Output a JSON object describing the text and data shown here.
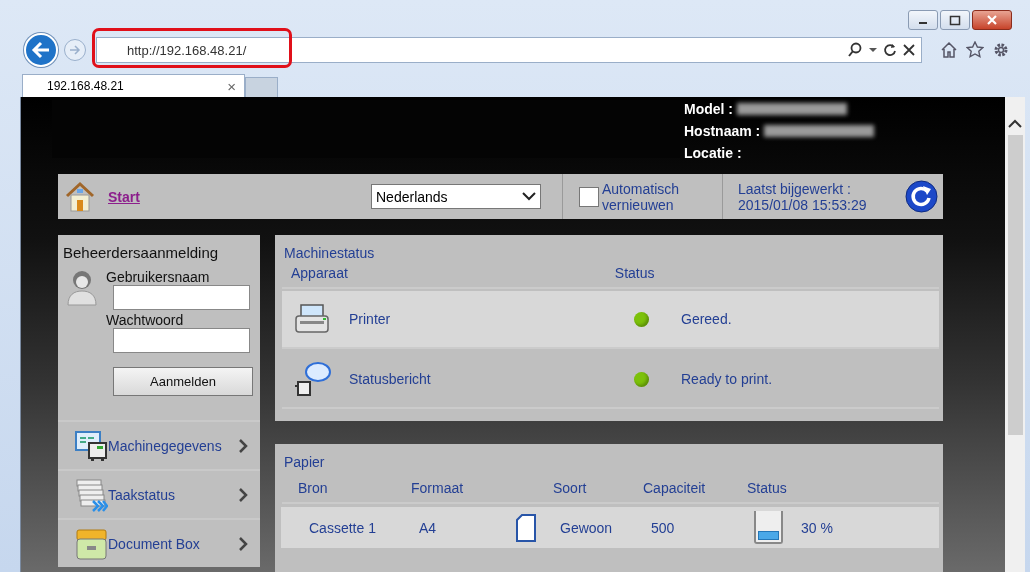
{
  "window": {
    "buttons": [
      {
        "kind": "minimize"
      },
      {
        "kind": "maximize"
      },
      {
        "kind": "close"
      }
    ]
  },
  "address_bar": {
    "url": "http://192.168.48.21/",
    "highlighted": true
  },
  "tabs": [
    {
      "label": "192.168.48.21",
      "close": "×",
      "selected": true
    }
  ],
  "device_info": [
    {
      "label": "Model :",
      "value_hidden": true
    },
    {
      "label": "Hostnaam :",
      "value_hidden": true
    },
    {
      "label": "Locatie :",
      "value_hidden": false
    }
  ],
  "toolbar": {
    "start_link": "Start",
    "language": "Nederlands",
    "auto_refresh": {
      "label": "Automatisch vernieuwen",
      "checked": false
    },
    "last_updated_label": "Laatst bijgewerkt :",
    "last_updated_value": "2015/01/08 15:53:29"
  },
  "login": {
    "title": "Beheerdersaanmelding",
    "username_label": "Gebruikersnaam",
    "password_label": "Wachtwoord",
    "button": "Aanmelden"
  },
  "nav": [
    {
      "label": "Machinegegevens",
      "kind": "machine"
    },
    {
      "label": "Taakstatus",
      "kind": "jobs"
    },
    {
      "label": "Document Box",
      "kind": "box"
    }
  ],
  "machine_status": {
    "title": "Machinestatus",
    "columns": [
      "Apparaat",
      "Status"
    ],
    "rows": [
      {
        "name": "Printer",
        "kind": "printer",
        "status": "Gereed.",
        "color": "#7cc10a",
        "highlighted": true
      },
      {
        "name": "Statusbericht",
        "kind": "message",
        "status": "Ready to print.",
        "color": "#7cc10a",
        "highlighted": false
      }
    ]
  },
  "paper": {
    "title": "Papier",
    "columns": [
      "Bron",
      "Formaat",
      "Soort",
      "Capaciteit",
      "Status"
    ],
    "rows": [
      {
        "source": "Cassette 1",
        "size": "A4",
        "type": "Gewoon",
        "capacity": "500",
        "level": 0.3,
        "reading": "30 %",
        "highlighted": true
      }
    ]
  }
}
